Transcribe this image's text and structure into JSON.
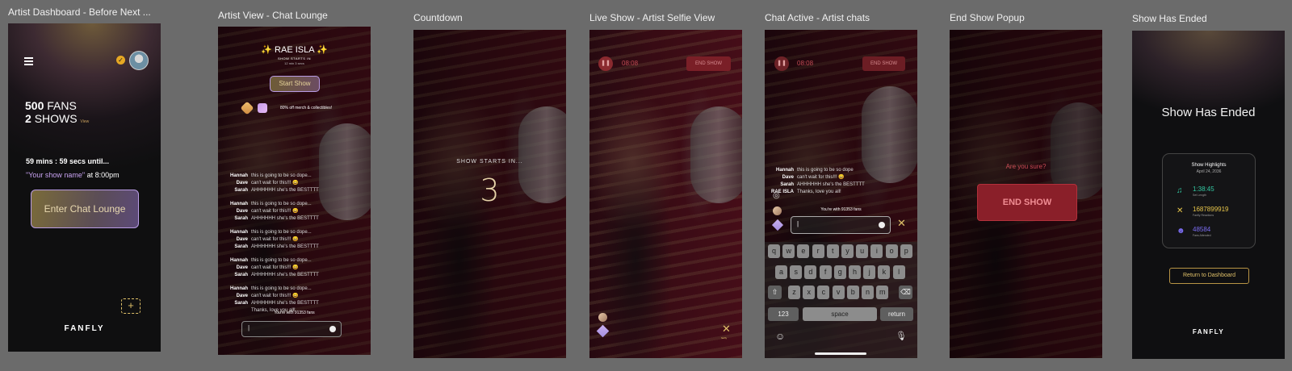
{
  "labels": {
    "s1": "Artist Dashboard - Before Next ...",
    "s2": "Artist View - Chat Lounge",
    "s3": "Countdown",
    "s4": "Live Show - Artist Selfie View",
    "s5": "Chat Active - Artist chats",
    "s6": "End Show Popup",
    "s7": "Show Has Ended"
  },
  "dashboard": {
    "fans_count": "500",
    "fans_label": "FANS",
    "shows_count": "2",
    "shows_label": "SHOWS",
    "view_link": "View",
    "countdown": "59 mins : 59 secs until...",
    "show_name": "\"Your show name\"",
    "show_time": " at 8:00pm",
    "cta": "Enter Chat Lounge",
    "add": "+",
    "logo": "FANFLY"
  },
  "lounge": {
    "artist": "✨  RAE ISLA  ✨",
    "starts_in": "SHOW STARTS IN",
    "starts_time": "12 min 3 secs",
    "start_button": "Start Show",
    "promo": "80% off merch & collectibles!",
    "chat": [
      {
        "user": "Hannah",
        "msg": "this is going to be so dope..."
      },
      {
        "user": "Dave",
        "msg": "can't wait for this!!! 😄"
      },
      {
        "user": "Sarah",
        "msg": "AHHHHHH she's the BESTTTT"
      },
      {
        "user": "Hannah",
        "msg": "this is going to be so dope..."
      },
      {
        "user": "Dave",
        "msg": "can't wait for this!!! 😄"
      },
      {
        "user": "Sarah",
        "msg": "AHHHHHH she's the BESTTTT"
      },
      {
        "user": "Hannah",
        "msg": "this is going to be so dope..."
      },
      {
        "user": "Dave",
        "msg": "can't wait for this!!! 😄"
      },
      {
        "user": "Sarah",
        "msg": "AHHHHHH she's the BESTTTT"
      },
      {
        "user": "Hannah",
        "msg": "this is going to be so dope..."
      },
      {
        "user": "Dave",
        "msg": "can't wait for this!!! 😄"
      },
      {
        "user": "Sarah",
        "msg": "AHHHHHH she's the BESTTTT"
      },
      {
        "user": "Hannah",
        "msg": "this is going to be so dope..."
      },
      {
        "user": "Dave",
        "msg": "can't wait for this!!! 😄"
      },
      {
        "user": "Sarah",
        "msg": "AHHHHHH she's the BESTTTT"
      },
      {
        "user": "",
        "msg": "Thanks, love you all!"
      }
    ],
    "fans_line": "You're with 91353 fans",
    "input_value": "|"
  },
  "countdown": {
    "label": "SHOW STARTS IN...",
    "number": "3"
  },
  "live": {
    "timer": "08:08",
    "end_button": "END SHOW",
    "brand_sub": "fanfly"
  },
  "chat_active": {
    "timer": "08:08",
    "end_button": "END SHOW",
    "chat": [
      {
        "user": "Hannah",
        "msg": "this is going to be so dope"
      },
      {
        "user": "Dave",
        "msg": "can't wait for this!!! 😄"
      },
      {
        "user": "Sarah",
        "msg": "AHHHHHH she's the BESTTTT"
      },
      {
        "user": "RAE ISLA",
        "msg": "Thanks, love you all!"
      }
    ],
    "fans_line": "You're with 91353 fans",
    "input_value": "|",
    "keys_row1": [
      "q",
      "w",
      "e",
      "r",
      "t",
      "y",
      "u",
      "i",
      "o",
      "p"
    ],
    "keys_row2": [
      "a",
      "s",
      "d",
      "f",
      "g",
      "h",
      "j",
      "k",
      "l"
    ],
    "keys_row3": [
      "z",
      "x",
      "c",
      "v",
      "b",
      "n",
      "m"
    ],
    "key_123": "123",
    "key_space": "space",
    "key_return": "return"
  },
  "end_popup": {
    "question": "Are you sure?",
    "button": "END SHOW"
  },
  "ended": {
    "title": "Show Has Ended",
    "card_title": "Show Highlights",
    "card_date": "April 24, 2036",
    "stats": [
      {
        "value": "1:38:45",
        "label": "Set Length",
        "color": "#33c9a3"
      },
      {
        "value": "1687899919",
        "label": "Fanfly Reactions",
        "color": "#e8c64a"
      },
      {
        "value": "48584",
        "label": "Fans Attended",
        "color": "#7a6cf0"
      }
    ],
    "return_button": "Return to Dashboard",
    "logo": "FANFLY"
  },
  "colors": {
    "gold": "#e0c169",
    "red_button": "#c22b33",
    "lavender": "#b69ae0"
  }
}
